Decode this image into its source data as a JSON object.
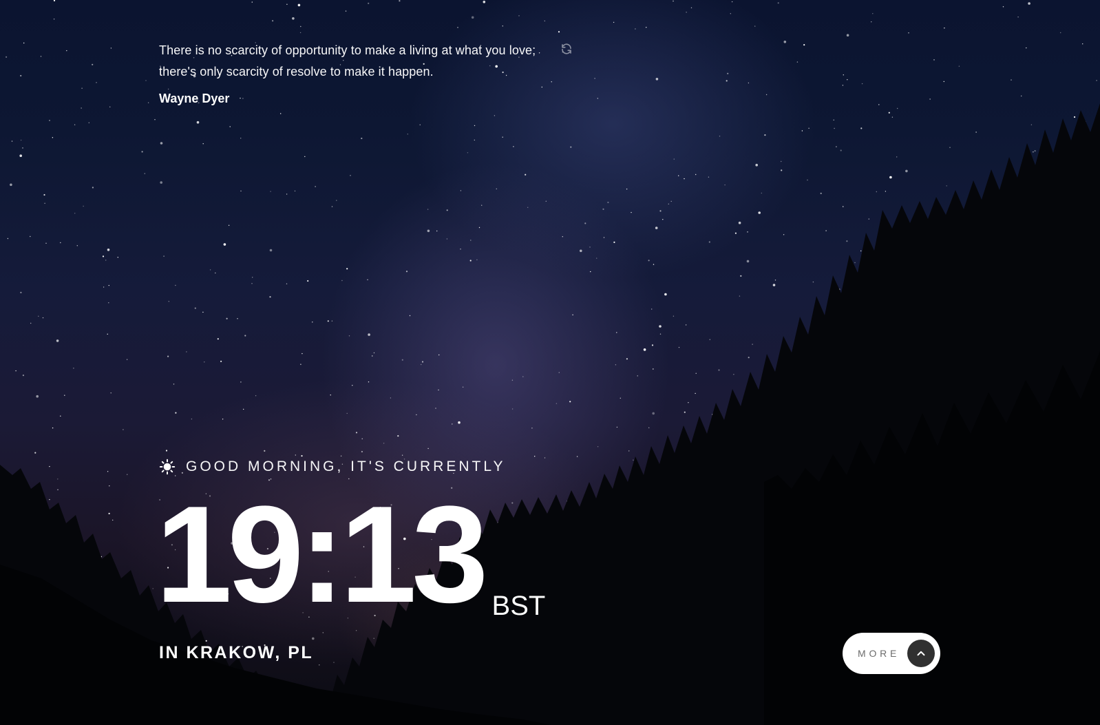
{
  "quote": {
    "text": "There is no scarcity of opportunity to make a living at what you love; there's only scarcity of resolve to make it happen.",
    "author": "Wayne Dyer",
    "refresh_icon": "refresh-icon"
  },
  "greeting": {
    "icon": "sun-icon",
    "text": "GOOD MORNING, IT'S CURRENTLY"
  },
  "clock": {
    "time": "19:13",
    "timezone": "BST"
  },
  "location": {
    "text": "IN KRAKOW, PL"
  },
  "more_button": {
    "label": "MORE",
    "icon": "chevron-up-icon"
  },
  "colors": {
    "button_bg": "#ffffff",
    "button_icon_bg": "#303030",
    "text": "#ffffff"
  }
}
